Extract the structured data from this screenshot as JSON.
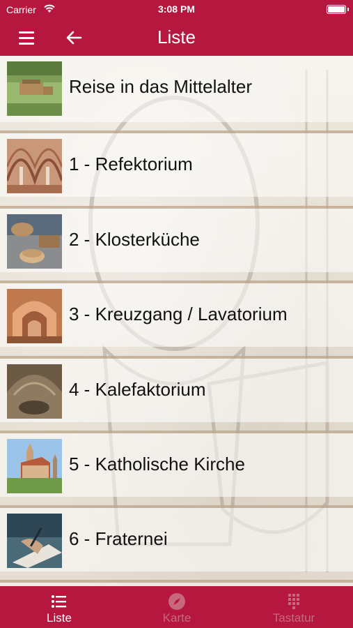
{
  "status_bar": {
    "carrier": "Carrier",
    "time": "3:08 PM"
  },
  "nav": {
    "title": "Liste",
    "menu_icon": "hamburger-icon",
    "back_icon": "arrow-left-icon"
  },
  "list": [
    {
      "label": "Reise in das Mittelalter"
    },
    {
      "label": "1 - Refektorium"
    },
    {
      "label": "2 - Klosterküche"
    },
    {
      "label": "3 - Kreuzgang / Lavatorium"
    },
    {
      "label": "4 - Kalefaktorium"
    },
    {
      "label": "5 - Katholische Kirche"
    },
    {
      "label": "6 - Fraternei"
    }
  ],
  "tabs": [
    {
      "label": "Liste",
      "icon": "list-icon",
      "active": true
    },
    {
      "label": "Karte",
      "icon": "compass-icon",
      "active": false
    },
    {
      "label": "Tastatur",
      "icon": "keypad-icon",
      "active": false
    }
  ],
  "colors": {
    "brand": "#b5173f",
    "inactive_tab": "#c7687f"
  }
}
